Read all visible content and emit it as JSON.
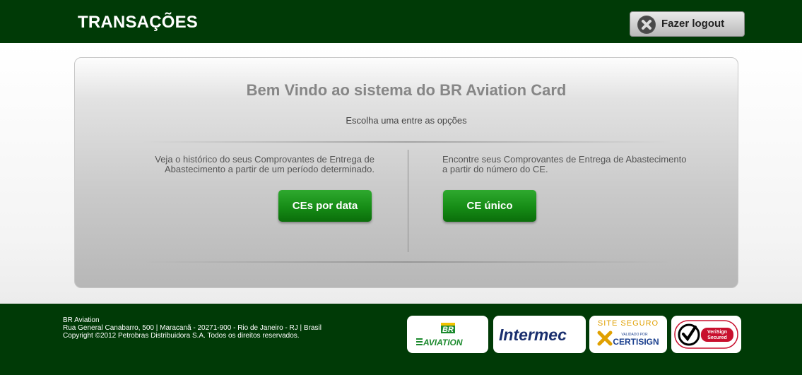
{
  "header": {
    "title": "TRANSAÇÕES",
    "logout_label": "Fazer logout"
  },
  "main": {
    "welcome": "Bem Vindo ao sistema do BR Aviation Card",
    "subtitle": "Escolha uma entre as opções",
    "left_option": {
      "description_line1": "Veja o histórico do seus Comprovantes de Entrega de",
      "description_line2": "Abastecimento a partir de um período determinado.",
      "button_label": "CEs por data"
    },
    "right_option": {
      "description_line1": "Encontre seus Comprovantes de Entrega de Abastecimento",
      "description_line2": "a partir do número do CE.",
      "button_label": "CE único"
    }
  },
  "footer": {
    "company": "BR Aviation",
    "address": "Rua General Canabarro, 500 | Maracanã - 20271-900 - Rio de Janeiro - RJ | Brasil",
    "copyright": "Copyright ©2012 Petrobras Distribuidora S.A. Todos os direitos reservados.",
    "badges": {
      "br_top": "BR",
      "br_bottom": "AVIATION",
      "intermec": "Intermec",
      "certisign_top": "SITE SEGURO",
      "certisign_mid": "VALIDADO POR",
      "certisign_bottom": "CERTISIGN",
      "verisign_top": "VeriSign",
      "verisign_bottom": "Secured"
    }
  },
  "colors": {
    "header_bg": "#003a06",
    "footer_bg": "#003a06",
    "button_green": "#168c16",
    "welcome_gray": "#868686"
  }
}
